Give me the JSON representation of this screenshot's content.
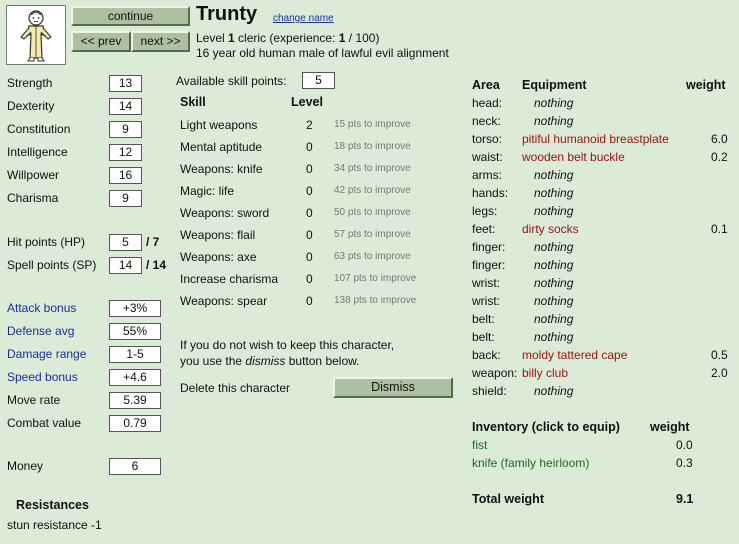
{
  "header": {
    "continue_label": "continue",
    "prev_label": "<< prev",
    "next_label": "next >>",
    "char_name": "Trunty",
    "change_name": "change name",
    "level_pre": "Level ",
    "level_num": "1",
    "level_mid": " cleric (experience: ",
    "exp_cur": "1",
    "exp_rest": " / 100)",
    "description": "16 year old human male of lawful evil alignment"
  },
  "attributes": [
    {
      "label": "Strength",
      "value": "13"
    },
    {
      "label": "Dexterity",
      "value": "14"
    },
    {
      "label": "Constitution",
      "value": "9"
    },
    {
      "label": "Intelligence",
      "value": "12"
    },
    {
      "label": "Willpower",
      "value": "16"
    },
    {
      "label": "Charisma",
      "value": "9"
    }
  ],
  "vitals": {
    "hp_label": "Hit points (HP)",
    "hp_value": "5",
    "hp_max": "/ 7",
    "sp_label": "Spell points (SP)",
    "sp_value": "14",
    "sp_max": "/ 14"
  },
  "combat": [
    {
      "label": "Attack bonus",
      "value": "+3%"
    },
    {
      "label": "Defense avg",
      "value": "55%"
    },
    {
      "label": "Damage range",
      "value": "1-5"
    },
    {
      "label": "Speed bonus",
      "value": "+4.6"
    },
    {
      "label": "Move rate",
      "value": "5.39"
    },
    {
      "label": "Combat value",
      "value": "0.79"
    }
  ],
  "money": {
    "label": "Money",
    "value": "6"
  },
  "resistances": {
    "title": "Resistances",
    "items": [
      "stun resistance -1"
    ]
  },
  "skills": {
    "available_label": "Available skill points:",
    "available_value": "5",
    "col_skill": "Skill",
    "col_level": "Level",
    "rows": [
      {
        "name": "Light weapons",
        "level": "2",
        "improve": "15 pts to improve"
      },
      {
        "name": "Mental aptitude",
        "level": "0",
        "improve": "18 pts to improve"
      },
      {
        "name": "Weapons: knife",
        "level": "0",
        "improve": "34 pts to improve"
      },
      {
        "name": "Magic: life",
        "level": "0",
        "improve": "42 pts to improve"
      },
      {
        "name": "Weapons: sword",
        "level": "0",
        "improve": "50 pts to improve"
      },
      {
        "name": "Weapons: flail",
        "level": "0",
        "improve": "57 pts to improve"
      },
      {
        "name": "Weapons: axe",
        "level": "0",
        "improve": "63 pts to improve"
      },
      {
        "name": "Increase charisma",
        "level": "0",
        "improve": "107 pts to improve"
      },
      {
        "name": "Weapons: spear",
        "level": "0",
        "improve": "138 pts to improve"
      }
    ]
  },
  "dismiss": {
    "text_line1": "If you do not wish to keep this character,",
    "text_line2_pre": "you use the ",
    "text_line2_em": "dismiss",
    "text_line2_post": " button below.",
    "delete_label": "Delete this character",
    "button_label": "Dismiss"
  },
  "equipment": {
    "col_area": "Area",
    "col_equipment": "Equipment",
    "col_weight": "weight",
    "rows": [
      {
        "area": "head:",
        "item": "nothing",
        "equipped": false,
        "weight": ""
      },
      {
        "area": "neck:",
        "item": "nothing",
        "equipped": false,
        "weight": ""
      },
      {
        "area": "torso:",
        "item": "pitiful humanoid breastplate",
        "equipped": true,
        "weight": "6.0"
      },
      {
        "area": "waist:",
        "item": "wooden belt buckle",
        "equipped": true,
        "weight": "0.2"
      },
      {
        "area": "arms:",
        "item": "nothing",
        "equipped": false,
        "weight": ""
      },
      {
        "area": "hands:",
        "item": "nothing",
        "equipped": false,
        "weight": ""
      },
      {
        "area": "legs:",
        "item": "nothing",
        "equipped": false,
        "weight": ""
      },
      {
        "area": "feet:",
        "item": "dirty socks",
        "equipped": true,
        "weight": "0.1"
      },
      {
        "area": "finger:",
        "item": "nothing",
        "equipped": false,
        "weight": ""
      },
      {
        "area": "finger:",
        "item": "nothing",
        "equipped": false,
        "weight": ""
      },
      {
        "area": "wrist:",
        "item": "nothing",
        "equipped": false,
        "weight": ""
      },
      {
        "area": "wrist:",
        "item": "nothing",
        "equipped": false,
        "weight": ""
      },
      {
        "area": "belt:",
        "item": "nothing",
        "equipped": false,
        "weight": ""
      },
      {
        "area": "belt:",
        "item": "nothing",
        "equipped": false,
        "weight": ""
      },
      {
        "area": "back:",
        "item": "moldy tattered cape",
        "equipped": true,
        "weight": "0.5"
      },
      {
        "area": "weapon:",
        "item": "billy club",
        "equipped": true,
        "weight": "2.0"
      },
      {
        "area": "shield:",
        "item": "nothing",
        "equipped": false,
        "weight": ""
      }
    ]
  },
  "inventory": {
    "title": "Inventory (click to equip)",
    "col_weight": "weight",
    "items": [
      {
        "name": "fist",
        "weight": "0.0"
      },
      {
        "name": "knife (family heirloom)",
        "weight": "0.3"
      }
    ],
    "total_label": "Total weight",
    "total_value": "9.1"
  }
}
